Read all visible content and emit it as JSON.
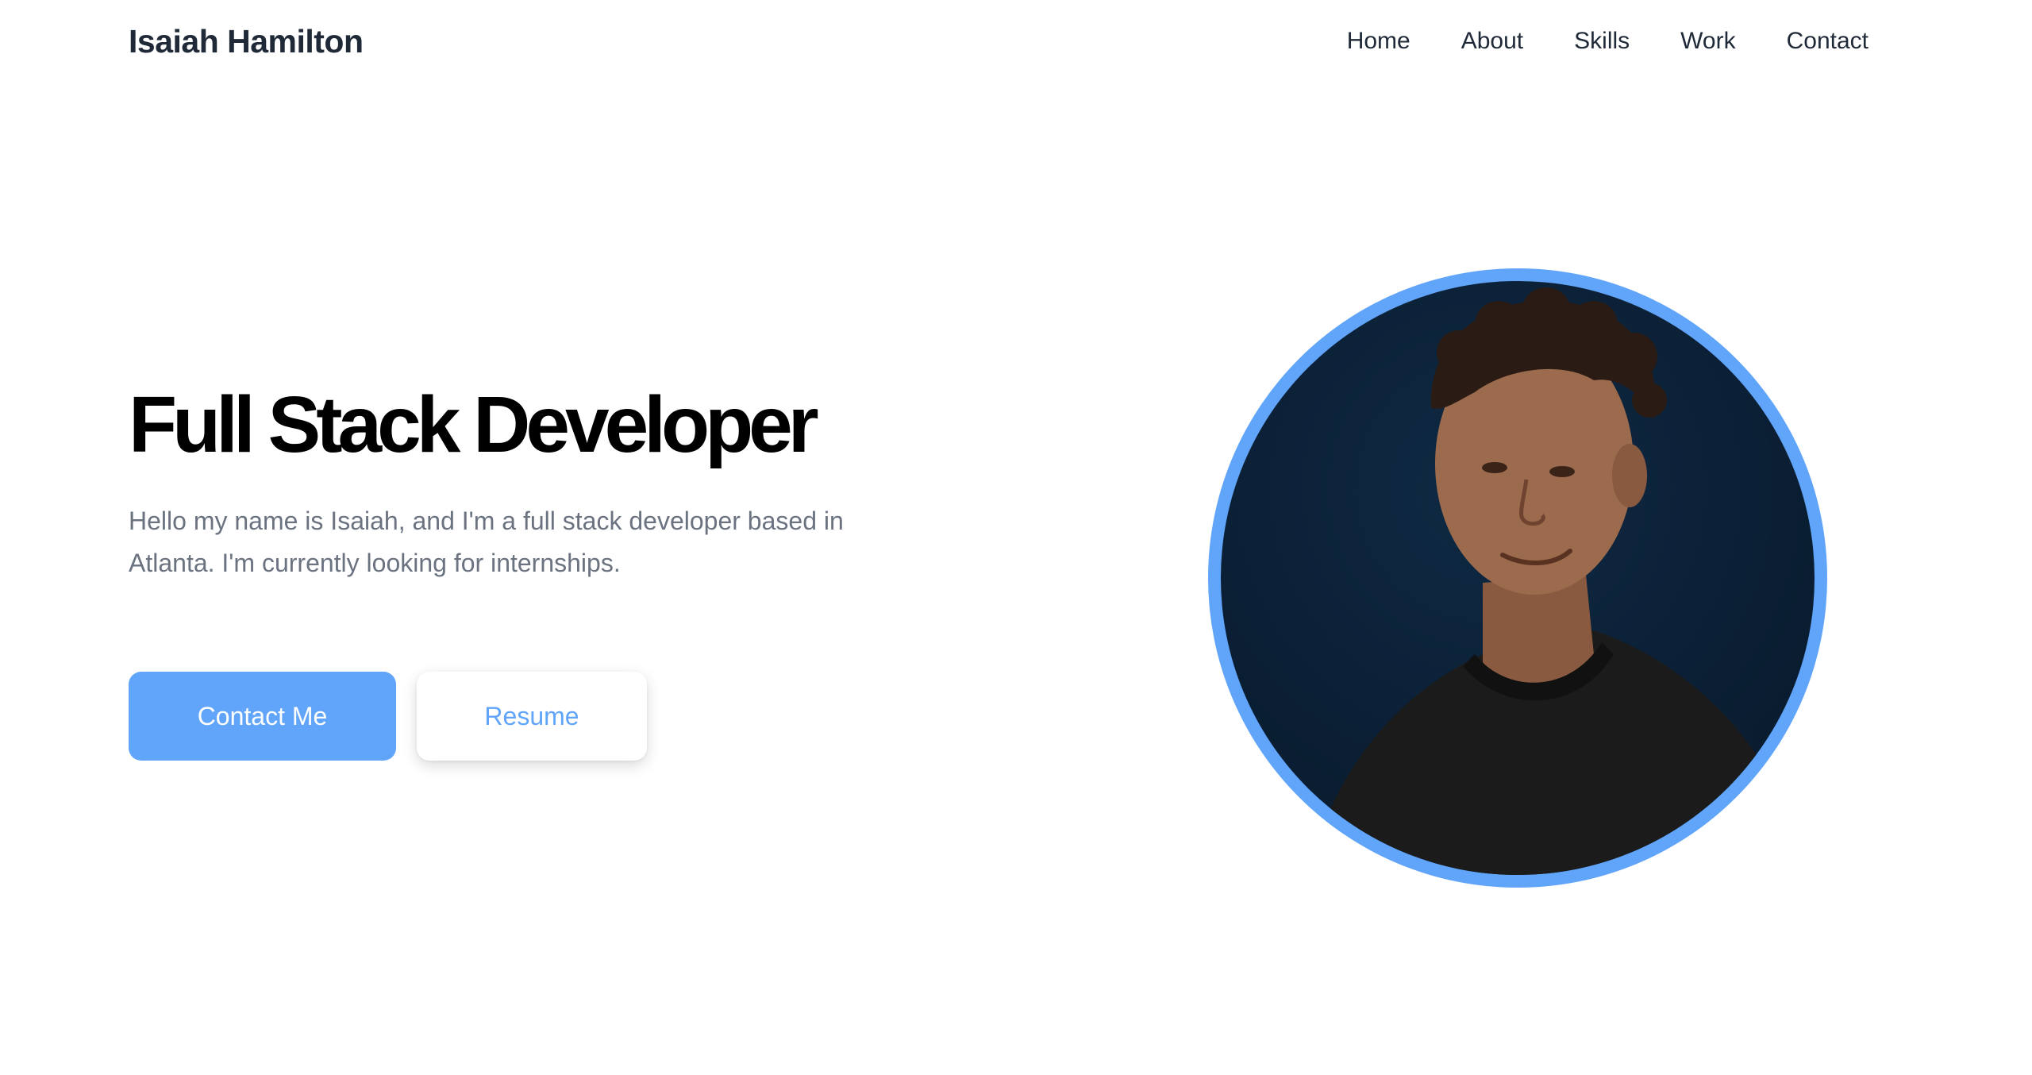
{
  "header": {
    "brand": "Isaiah Hamilton",
    "nav": [
      {
        "label": "Home"
      },
      {
        "label": "About"
      },
      {
        "label": "Skills"
      },
      {
        "label": "Work"
      },
      {
        "label": "Contact"
      }
    ]
  },
  "hero": {
    "title": "Full Stack Developer",
    "description": "Hello my name is Isaiah, and I'm a full stack developer based in Atlanta. I'm currently looking for internships.",
    "primary_button": "Contact Me",
    "secondary_button": "Resume"
  },
  "colors": {
    "accent": "#60a5fa",
    "heading": "#000000",
    "nav_text": "#1f2937",
    "body_text": "#6b7280",
    "photo_background": "#0b1f35"
  }
}
